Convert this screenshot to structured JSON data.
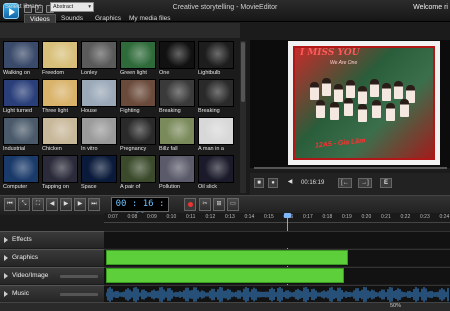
{
  "window": {
    "title": "Creative storytelling - MovieEditor",
    "welcome": "Welcome ri"
  },
  "tabs": [
    {
      "label": "Videos",
      "active": true
    },
    {
      "label": "Sounds",
      "active": false
    },
    {
      "label": "Graphics",
      "active": false
    },
    {
      "label": "My media files",
      "active": false
    }
  ],
  "library": {
    "label": "Select library:",
    "selected": "Abstract"
  },
  "media_items": [
    {
      "label": "Walking on",
      "color": "#3a4a6a"
    },
    {
      "label": "Freedom",
      "color": "#d8c07a"
    },
    {
      "label": "Lonley",
      "color": "#5a5a5a"
    },
    {
      "label": "Green light",
      "color": "#2f6b3a"
    },
    {
      "label": "One",
      "color": "#111111"
    },
    {
      "label": "Lightbulb",
      "color": "#1d1d1d"
    },
    {
      "label": "Light turned",
      "color": "#2a3f7a"
    },
    {
      "label": "Three light",
      "color": "#d9b36a"
    },
    {
      "label": "House",
      "color": "#9aa8b8"
    },
    {
      "label": "Fighting",
      "color": "#6a4a3a"
    },
    {
      "label": "Breaking",
      "color": "#3a3a3a"
    },
    {
      "label": "Breaking",
      "color": "#2a2a2a"
    },
    {
      "label": "Industrial",
      "color": "#4a5a6a"
    },
    {
      "label": "Chicken",
      "color": "#c8b89a"
    },
    {
      "label": "In vitro",
      "color": "#9a9a9a"
    },
    {
      "label": "Pregnancy",
      "color": "#2a2a2a"
    },
    {
      "label": "Billz fall",
      "color": "#7a8a5a"
    },
    {
      "label": "A man in a",
      "color": "#d8d8d8"
    },
    {
      "label": "Computer",
      "color": "#1a3a6a"
    },
    {
      "label": "Tapping on",
      "color": "#2a2a3a"
    },
    {
      "label": "Space",
      "color": "#0a1a3a"
    },
    {
      "label": "A pair of",
      "color": "#3a4a2a"
    },
    {
      "label": "Pollution",
      "color": "#5a5a6a"
    },
    {
      "label": "Oil slick",
      "color": "#1a1a2a"
    }
  ],
  "preview": {
    "caption_top": "I MISS YOU",
    "caption_sub": "We Are One",
    "caption_bottom": "12A5 - Gia Lâm",
    "time": "00:16:19"
  },
  "timeline": {
    "time": "00 : 16 : 19",
    "ruler_labels": [
      "0:07",
      "0:08",
      "0:09",
      "0:10",
      "0:11",
      "0:12",
      "0:13",
      "0:14",
      "0:15",
      "0:16",
      "0:17",
      "0:18",
      "0:19",
      "0:20",
      "0:21",
      "0:22",
      "0:23",
      "0:24"
    ],
    "tracks": [
      {
        "name": "Effects"
      },
      {
        "name": "Graphics"
      },
      {
        "name": "Video/Image"
      },
      {
        "name": "Music"
      }
    ],
    "zoom": "50%"
  },
  "colors": {
    "clip_green": "#5ccf3a",
    "accent_blue": "#6ec1ff"
  }
}
